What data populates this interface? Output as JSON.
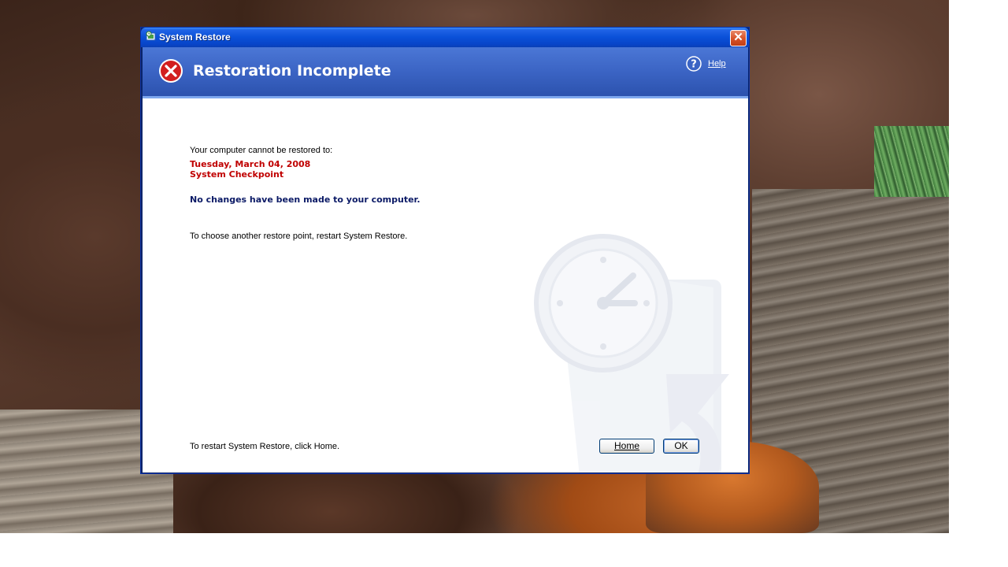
{
  "window": {
    "title": "System Restore",
    "close_label": "✕"
  },
  "header": {
    "title": "Restoration Incomplete",
    "help_label": "Help"
  },
  "content": {
    "intro": "Your computer cannot be restored to:",
    "restore_date": "Tuesday, March 04, 2008",
    "restore_point": "System Checkpoint",
    "no_changes": "No changes have been made to your computer.",
    "choose_another": "To choose another restore point, restart System Restore.",
    "restart_hint": "To restart System Restore, click Home."
  },
  "buttons": {
    "home_label": "Home",
    "ok_label": "OK"
  },
  "icons": {
    "title": "system-restore-icon",
    "header": "error-icon",
    "help": "help-icon",
    "watermark": "restore-clock-watermark-icon"
  },
  "colors": {
    "title_bar": "#0a50d8",
    "header_band": "#3b64c4",
    "error_red": "#c00000",
    "navy_text": "#0b1a66"
  }
}
